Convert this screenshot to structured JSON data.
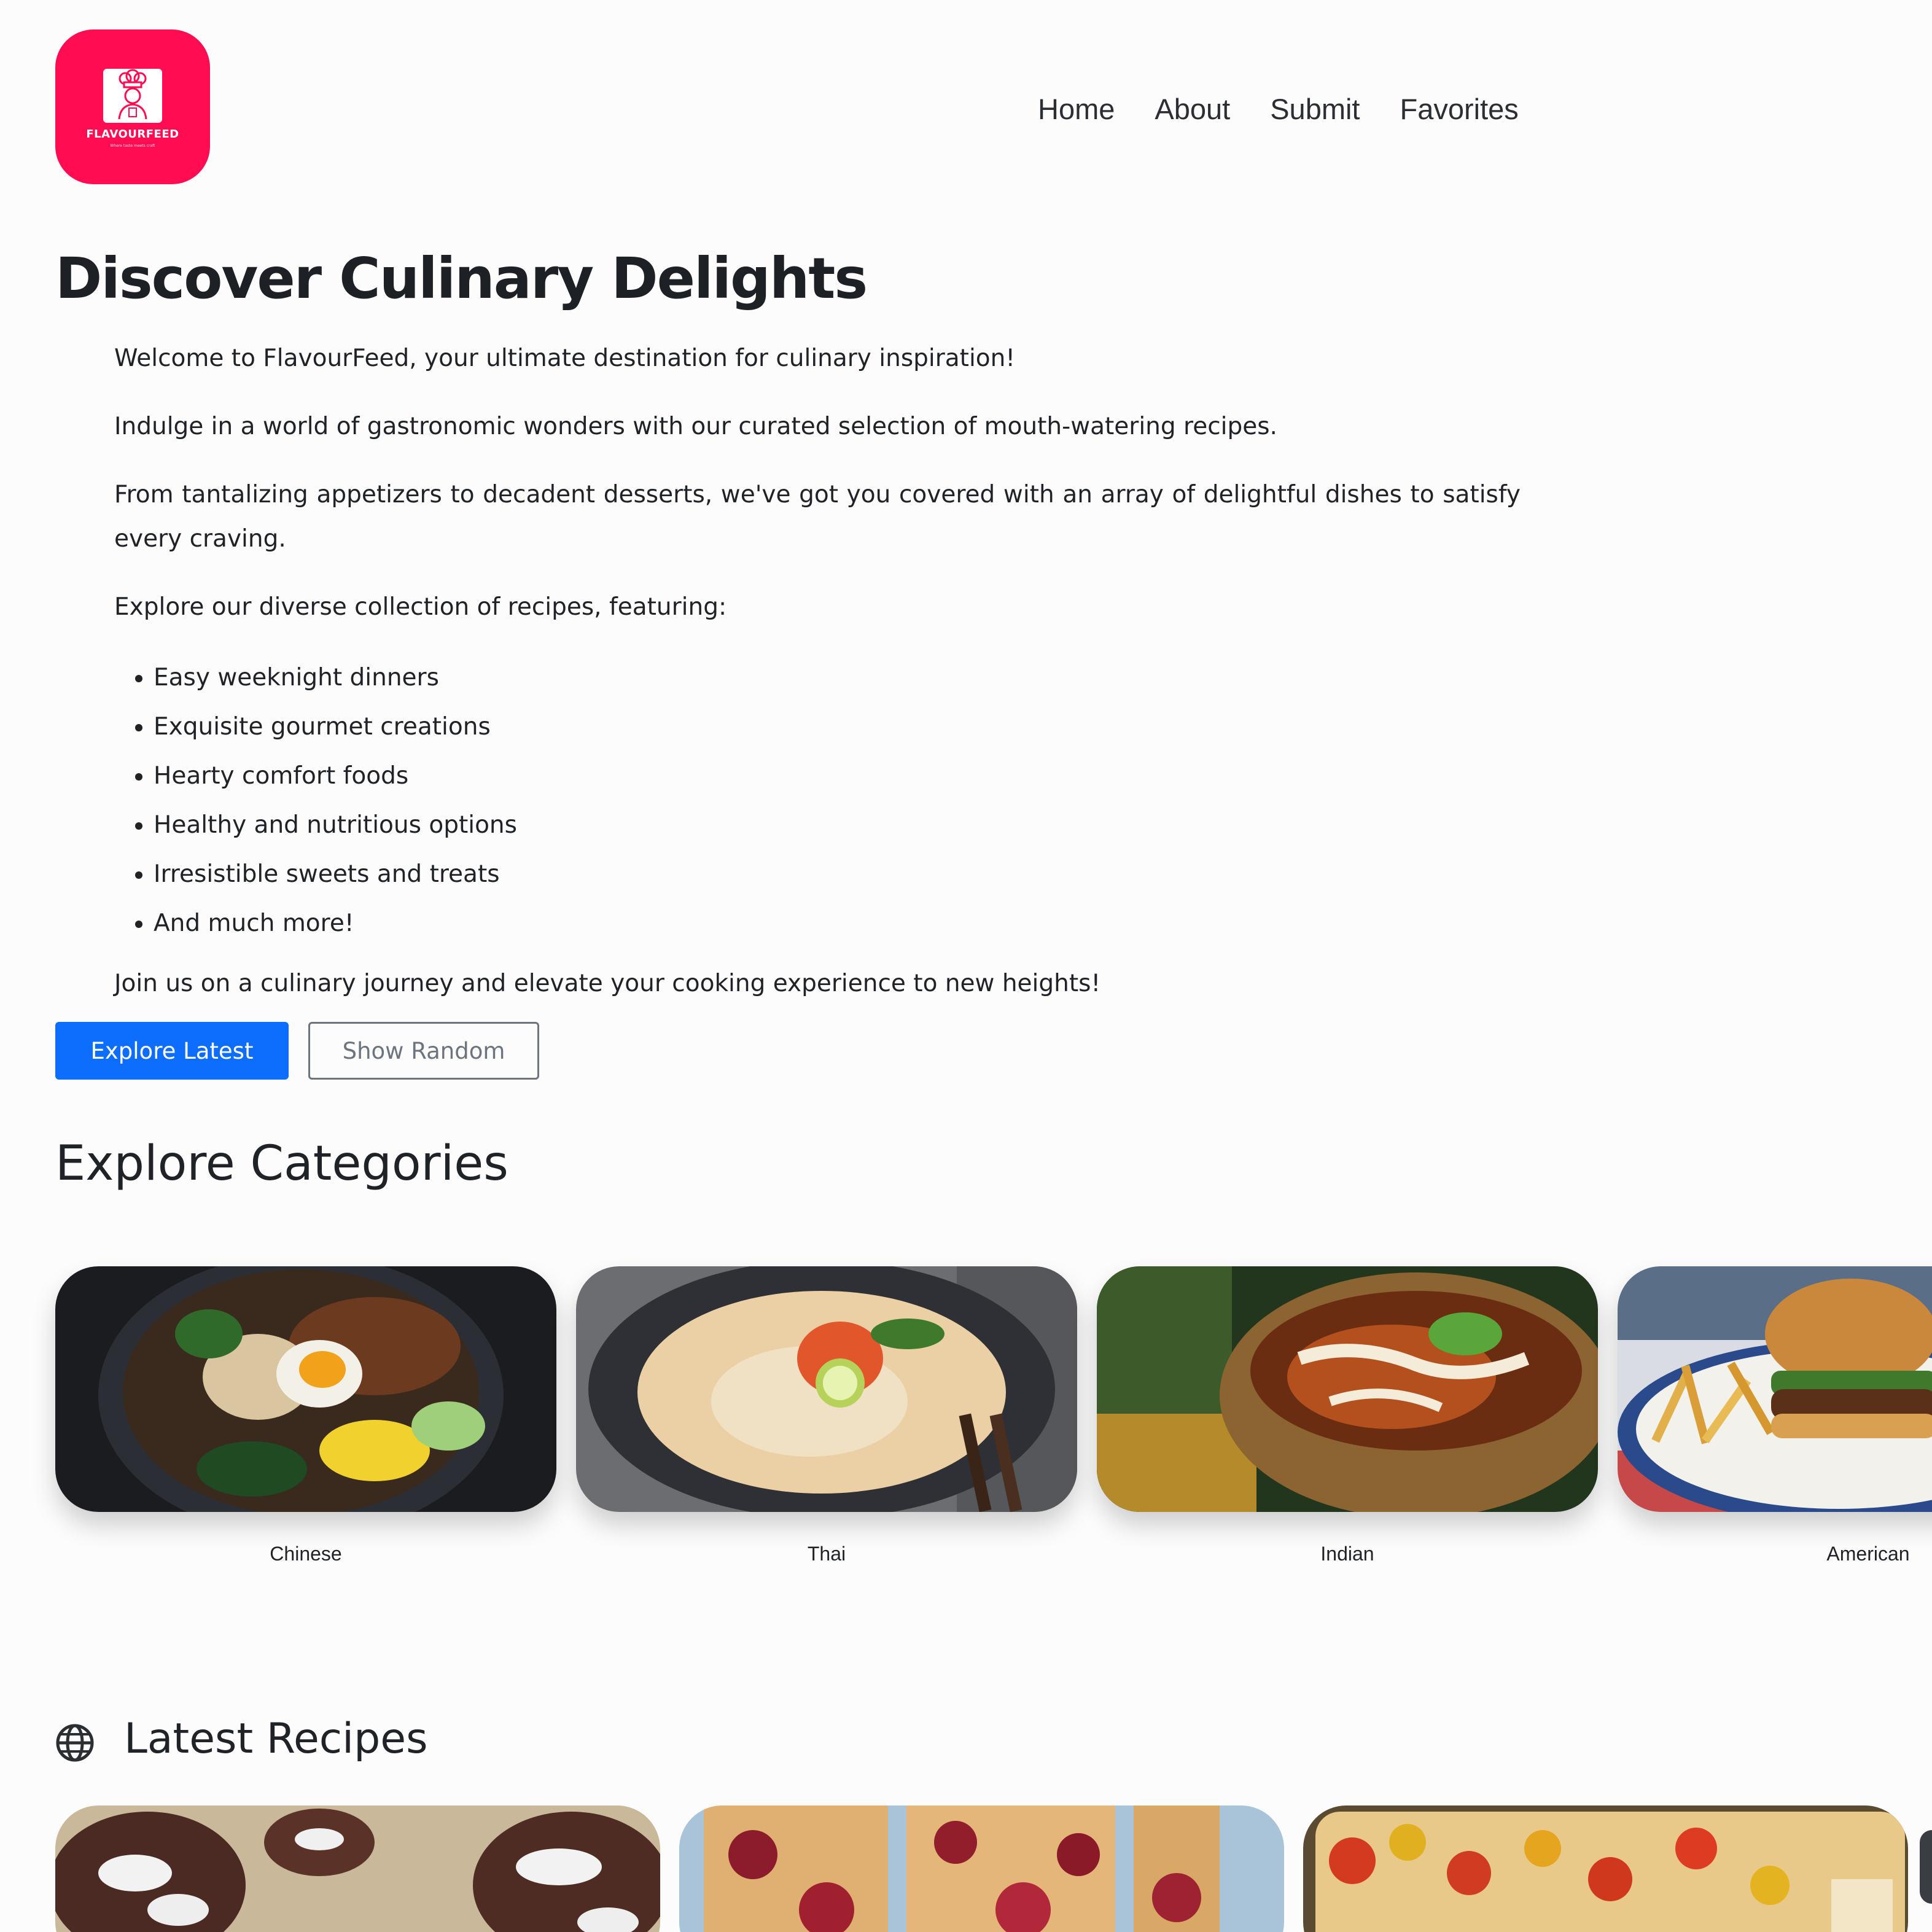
{
  "brand": {
    "logo_text": "FLAVOURFEED",
    "logo_tagline": "Where taste meets craft",
    "logo_color": "#ff0c52"
  },
  "nav": {
    "items": [
      "Home",
      "About",
      "Submit",
      "Favorites"
    ]
  },
  "hero": {
    "title": "Discover Culinary Delights",
    "intro": "Welcome to FlavourFeed, your ultimate destination for culinary inspiration!",
    "para2": "Indulge in a world of gastronomic wonders with our curated selection of mouth-watering recipes.",
    "para3": "From tantalizing appetizers to decadent desserts, we've got you covered with an array of delightful dishes to satisfy every craving.",
    "para4": "Explore our diverse collection of recipes, featuring:",
    "features": [
      "Easy weeknight dinners",
      "Exquisite gourmet creations",
      "Hearty comfort foods",
      "Healthy and nutritious options",
      "Irresistible sweets and treats",
      "And much more!"
    ],
    "closing": "Join us on a culinary journey and elevate your cooking experience to new heights!"
  },
  "buttons": {
    "explore_latest": "Explore Latest",
    "show_random": "Show Random",
    "primary_color": "#0d6efd",
    "secondary_color": "#6c757d"
  },
  "categories": {
    "title": "Explore Categories",
    "items": [
      {
        "label": "Chinese"
      },
      {
        "label": "Thai"
      },
      {
        "label": "Indian"
      },
      {
        "label": "American"
      }
    ]
  },
  "latest": {
    "title": "Latest Recipes",
    "icon": "globe-icon"
  }
}
